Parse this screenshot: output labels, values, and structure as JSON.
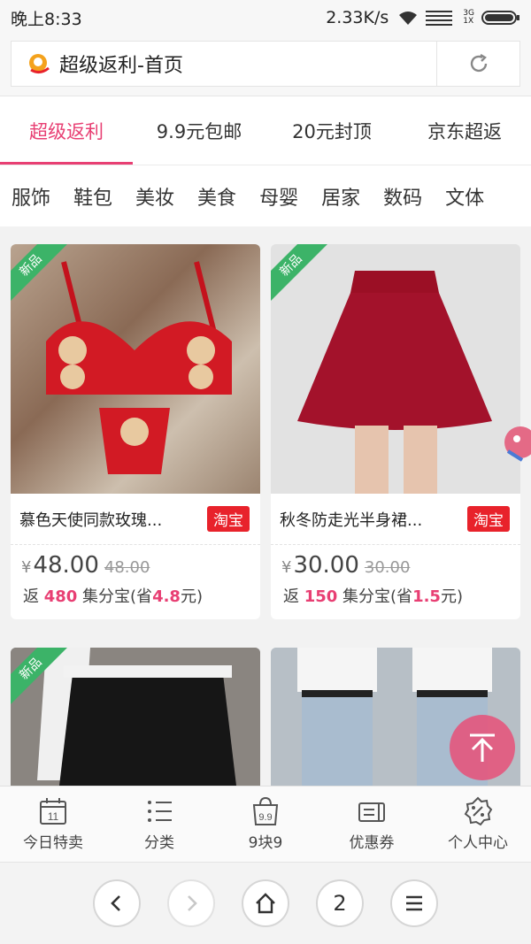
{
  "status_bar": {
    "time": "晚上8:33",
    "speed": "2.33K/s",
    "network_3g": "3G",
    "network_1x": "1X"
  },
  "url_bar": {
    "title": "超级返利-首页",
    "logo_icon": "app-logo-icon",
    "reload_icon": "reload-icon"
  },
  "top_tabs": [
    {
      "label": "超级返利",
      "active": true
    },
    {
      "label": "9.9元包邮",
      "active": false
    },
    {
      "label": "20元封顶",
      "active": false
    },
    {
      "label": "京东超返",
      "active": false
    }
  ],
  "categories": [
    "服饰",
    "鞋包",
    "美妆",
    "美食",
    "母婴",
    "居家",
    "数码",
    "文体"
  ],
  "products": [
    {
      "badge": "新品",
      "name": "慕色天使同款玫瑰...",
      "platform": "淘宝",
      "currency": "¥",
      "price": "48.00",
      "original_price": "48.00",
      "rebate_prefix": "返 ",
      "rebate_points": "480",
      "rebate_mid": " 集分宝(省",
      "rebate_save": "4.8",
      "rebate_suffix": "元)"
    },
    {
      "badge": "新品",
      "name": "秋冬防走光半身裙...",
      "platform": "淘宝",
      "currency": "¥",
      "price": "30.00",
      "original_price": "30.00",
      "rebate_prefix": "返 ",
      "rebate_points": "150",
      "rebate_mid": " 集分宝(省",
      "rebate_save": "1.5",
      "rebate_suffix": "元)"
    },
    {
      "badge": "新品"
    },
    {
      "badge": ""
    }
  ],
  "bottom_nav": [
    {
      "label": "今日特卖",
      "icon": "calendar-icon",
      "icon_text": "11"
    },
    {
      "label": "分类",
      "icon": "list-icon"
    },
    {
      "label": "9块9",
      "icon": "price-bag-icon",
      "icon_text": "9.9"
    },
    {
      "label": "优惠券",
      "icon": "coupon-icon"
    },
    {
      "label": "个人中心",
      "icon": "percent-badge-icon"
    }
  ],
  "browser_toolbar": {
    "back_icon": "chevron-left-icon",
    "forward_icon": "chevron-right-icon",
    "home_icon": "home-icon",
    "tab_count": "2",
    "menu_icon": "menu-icon"
  },
  "colors": {
    "accent": "#e83f73",
    "taobao_red": "#e8222b",
    "new_badge_green": "#3cb368"
  }
}
